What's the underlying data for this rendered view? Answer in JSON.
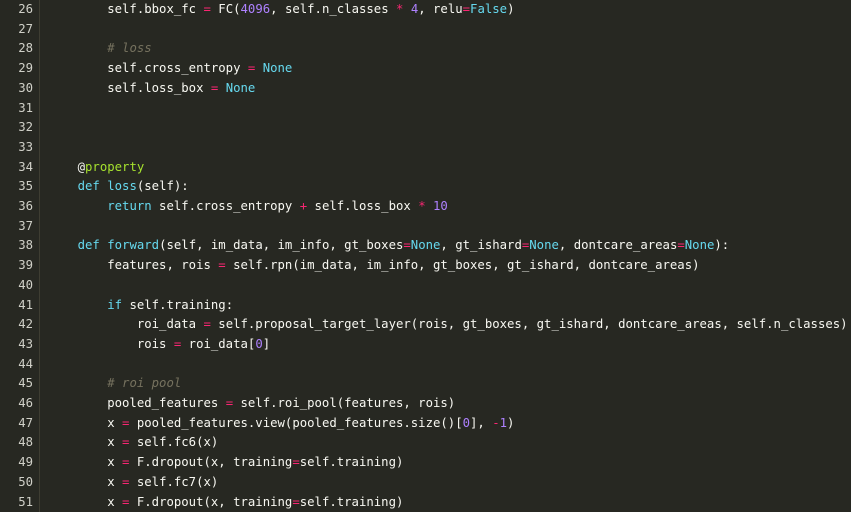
{
  "editor": {
    "lines": [
      {
        "num": "26",
        "tokens": [
          {
            "t": "        self.bbox_fc ",
            "c": "tok-plain"
          },
          {
            "t": "=",
            "c": "tok-op"
          },
          {
            "t": " FC(",
            "c": "tok-plain"
          },
          {
            "t": "4096",
            "c": "tok-num"
          },
          {
            "t": ", self.n_classes ",
            "c": "tok-plain"
          },
          {
            "t": "*",
            "c": "tok-op"
          },
          {
            "t": " ",
            "c": "tok-plain"
          },
          {
            "t": "4",
            "c": "tok-num"
          },
          {
            "t": ", relu",
            "c": "tok-plain"
          },
          {
            "t": "=",
            "c": "tok-op"
          },
          {
            "t": "False",
            "c": "tok-const"
          },
          {
            "t": ")",
            "c": "tok-plain"
          }
        ]
      },
      {
        "num": "27",
        "tokens": []
      },
      {
        "num": "28",
        "tokens": [
          {
            "t": "        ",
            "c": "tok-plain"
          },
          {
            "t": "# loss",
            "c": "tok-comment"
          }
        ]
      },
      {
        "num": "29",
        "tokens": [
          {
            "t": "        self.cross_entropy ",
            "c": "tok-plain"
          },
          {
            "t": "=",
            "c": "tok-op"
          },
          {
            "t": " ",
            "c": "tok-plain"
          },
          {
            "t": "None",
            "c": "tok-const"
          }
        ]
      },
      {
        "num": "30",
        "tokens": [
          {
            "t": "        self.loss_box ",
            "c": "tok-plain"
          },
          {
            "t": "=",
            "c": "tok-op"
          },
          {
            "t": " ",
            "c": "tok-plain"
          },
          {
            "t": "None",
            "c": "tok-const"
          }
        ]
      },
      {
        "num": "31",
        "tokens": []
      },
      {
        "num": "32",
        "tokens": []
      },
      {
        "num": "33",
        "tokens": []
      },
      {
        "num": "34",
        "tokens": [
          {
            "t": "    ",
            "c": "tok-plain"
          },
          {
            "t": "@",
            "c": "tok-deco-at"
          },
          {
            "t": "property",
            "c": "tok-deco"
          }
        ]
      },
      {
        "num": "35",
        "tokens": [
          {
            "t": "    ",
            "c": "tok-plain"
          },
          {
            "t": "def",
            "c": "tok-kw"
          },
          {
            "t": " ",
            "c": "tok-plain"
          },
          {
            "t": "loss",
            "c": "tok-fname"
          },
          {
            "t": "(self):",
            "c": "tok-plain"
          }
        ]
      },
      {
        "num": "36",
        "tokens": [
          {
            "t": "        ",
            "c": "tok-plain"
          },
          {
            "t": "return",
            "c": "tok-kw"
          },
          {
            "t": " self.cross_entropy ",
            "c": "tok-plain"
          },
          {
            "t": "+",
            "c": "tok-op"
          },
          {
            "t": " self.loss_box ",
            "c": "tok-plain"
          },
          {
            "t": "*",
            "c": "tok-op"
          },
          {
            "t": " ",
            "c": "tok-plain"
          },
          {
            "t": "10",
            "c": "tok-num"
          }
        ]
      },
      {
        "num": "37",
        "tokens": []
      },
      {
        "num": "38",
        "tokens": [
          {
            "t": "    ",
            "c": "tok-plain"
          },
          {
            "t": "def",
            "c": "tok-kw"
          },
          {
            "t": " ",
            "c": "tok-plain"
          },
          {
            "t": "forward",
            "c": "tok-fname"
          },
          {
            "t": "(self, im_data, im_info, gt_boxes",
            "c": "tok-plain"
          },
          {
            "t": "=",
            "c": "tok-op"
          },
          {
            "t": "None",
            "c": "tok-const"
          },
          {
            "t": ", gt_ishard",
            "c": "tok-plain"
          },
          {
            "t": "=",
            "c": "tok-op"
          },
          {
            "t": "None",
            "c": "tok-const"
          },
          {
            "t": ", dontcare_areas",
            "c": "tok-plain"
          },
          {
            "t": "=",
            "c": "tok-op"
          },
          {
            "t": "None",
            "c": "tok-const"
          },
          {
            "t": "):",
            "c": "tok-plain"
          }
        ]
      },
      {
        "num": "39",
        "tokens": [
          {
            "t": "        features, rois ",
            "c": "tok-plain"
          },
          {
            "t": "=",
            "c": "tok-op"
          },
          {
            "t": " self.rpn(im_data, im_info, gt_boxes, gt_ishard, dontcare_areas)",
            "c": "tok-plain"
          }
        ]
      },
      {
        "num": "40",
        "tokens": []
      },
      {
        "num": "41",
        "tokens": [
          {
            "t": "        ",
            "c": "tok-plain"
          },
          {
            "t": "if",
            "c": "tok-kw"
          },
          {
            "t": " self.training:",
            "c": "tok-plain"
          }
        ]
      },
      {
        "num": "42",
        "tokens": [
          {
            "t": "            roi_data ",
            "c": "tok-plain"
          },
          {
            "t": "=",
            "c": "tok-op"
          },
          {
            "t": " self.proposal_target_layer(rois, gt_boxes, gt_ishard, dontcare_areas, self.n_classes)",
            "c": "tok-plain"
          }
        ]
      },
      {
        "num": "43",
        "tokens": [
          {
            "t": "            rois ",
            "c": "tok-plain"
          },
          {
            "t": "=",
            "c": "tok-op"
          },
          {
            "t": " roi_data[",
            "c": "tok-plain"
          },
          {
            "t": "0",
            "c": "tok-num"
          },
          {
            "t": "]",
            "c": "tok-plain"
          }
        ]
      },
      {
        "num": "44",
        "tokens": []
      },
      {
        "num": "45",
        "tokens": [
          {
            "t": "        ",
            "c": "tok-plain"
          },
          {
            "t": "# roi pool",
            "c": "tok-comment"
          }
        ]
      },
      {
        "num": "46",
        "tokens": [
          {
            "t": "        pooled_features ",
            "c": "tok-plain"
          },
          {
            "t": "=",
            "c": "tok-op"
          },
          {
            "t": " self.roi_pool(features, rois)",
            "c": "tok-plain"
          }
        ]
      },
      {
        "num": "47",
        "tokens": [
          {
            "t": "        x ",
            "c": "tok-plain"
          },
          {
            "t": "=",
            "c": "tok-op"
          },
          {
            "t": " pooled_features.view(pooled_features.size()[",
            "c": "tok-plain"
          },
          {
            "t": "0",
            "c": "tok-num"
          },
          {
            "t": "], ",
            "c": "tok-plain"
          },
          {
            "t": "-",
            "c": "tok-op"
          },
          {
            "t": "1",
            "c": "tok-num"
          },
          {
            "t": ")",
            "c": "tok-plain"
          }
        ]
      },
      {
        "num": "48",
        "tokens": [
          {
            "t": "        x ",
            "c": "tok-plain"
          },
          {
            "t": "=",
            "c": "tok-op"
          },
          {
            "t": " self.fc6(x)",
            "c": "tok-plain"
          }
        ]
      },
      {
        "num": "49",
        "tokens": [
          {
            "t": "        x ",
            "c": "tok-plain"
          },
          {
            "t": "=",
            "c": "tok-op"
          },
          {
            "t": " F.dropout(x, training",
            "c": "tok-plain"
          },
          {
            "t": "=",
            "c": "tok-op"
          },
          {
            "t": "self.training)",
            "c": "tok-plain"
          }
        ]
      },
      {
        "num": "50",
        "tokens": [
          {
            "t": "        x ",
            "c": "tok-plain"
          },
          {
            "t": "=",
            "c": "tok-op"
          },
          {
            "t": " self.fc7(x)",
            "c": "tok-plain"
          }
        ]
      },
      {
        "num": "51",
        "tokens": [
          {
            "t": "        x ",
            "c": "tok-plain"
          },
          {
            "t": "=",
            "c": "tok-op"
          },
          {
            "t": " F.dropout(x, training",
            "c": "tok-plain"
          },
          {
            "t": "=",
            "c": "tok-op"
          },
          {
            "t": "self.training)",
            "c": "tok-plain"
          }
        ]
      }
    ]
  }
}
